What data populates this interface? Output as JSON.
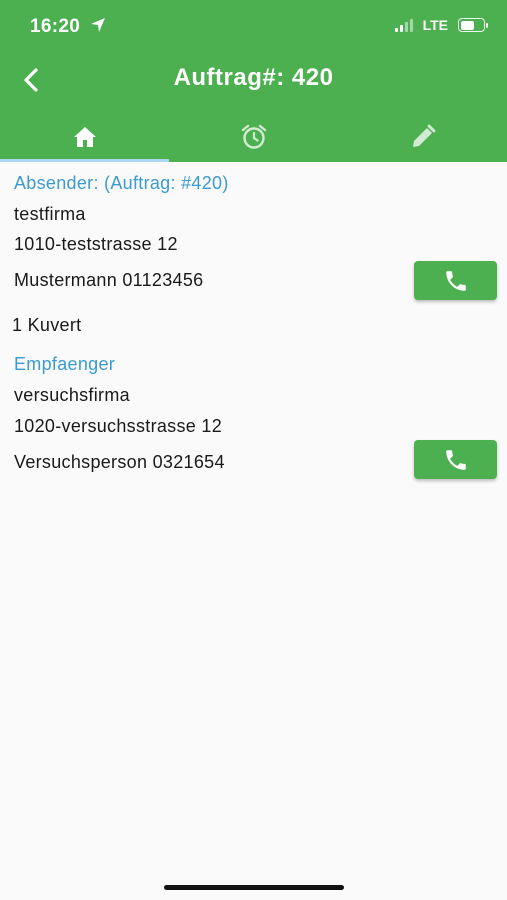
{
  "status_bar": {
    "time": "16:20",
    "network": "LTE",
    "battery_level": 0.6
  },
  "appbar": {
    "title": "Auftrag#: 420",
    "background": "#4caf50"
  },
  "tabs": [
    {
      "icon": "home-icon",
      "selected": true
    },
    {
      "icon": "alarm-clock-icon",
      "selected": false
    },
    {
      "icon": "pencil-icon",
      "selected": false
    }
  ],
  "sender": {
    "header": "Absender: (Auftrag: #420)",
    "company": "testfirma",
    "address": "1010-teststrasse 12",
    "contact": "Mustermann 01123456"
  },
  "package": "1 Kuvert",
  "recipient": {
    "header": "Empfaenger",
    "company": "versuchsfirma",
    "address": "1020-versuchsstrasse 12",
    "contact": "Versuchsperson 0321654"
  },
  "accent_color": "#3a9bd0"
}
